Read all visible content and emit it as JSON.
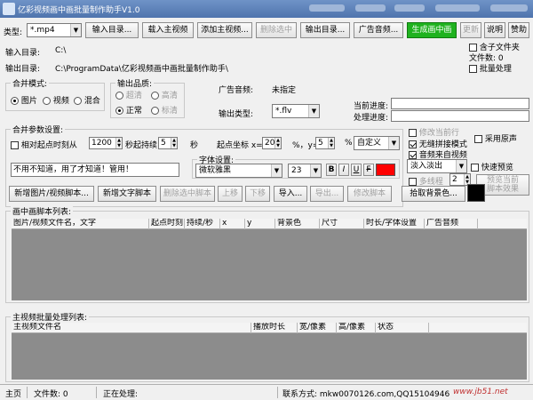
{
  "window": {
    "title": "亿彩视频画中画批量制作助手V1.0"
  },
  "toolbar": {
    "type_label": "类型:",
    "type_value": "*.mp4",
    "input_dir_btn": "输入目录...",
    "load_main_video": "载入主视频",
    "add_main_video": "添加主视频...",
    "delete_selected": "删除选中",
    "output_dir_btn": "输出目录...",
    "ad_audio": "广告音频...",
    "generate_pip": "生成画中画",
    "update": "更新",
    "help": "说明",
    "sponsor": "赞助"
  },
  "paths": {
    "input_label": "输入目录:",
    "input_value": "C:\\",
    "output_label": "输出目录:",
    "output_value": "C:\\ProgramData\\亿彩视频画中画批量制作助手\\"
  },
  "right_options": {
    "include_subfolders": "含子文件夹",
    "file_count": "文件数: 0",
    "batch_processing": "批量处理"
  },
  "merge_mode": {
    "title": "合并模式:",
    "options": [
      "图片",
      "视频",
      "混合"
    ],
    "selected": "图片"
  },
  "output_quality": {
    "title": "输出品质:",
    "options": [
      "超清",
      "高清",
      "正常",
      "标清"
    ],
    "selected": "正常"
  },
  "ad_audio_info": {
    "label": "广告音频:",
    "value": "未指定"
  },
  "output_type": {
    "label": "输出类型:",
    "value": "*.flv"
  },
  "progress": {
    "current_label": "当前进度:",
    "process_label": "处理进度:"
  },
  "merge_params": {
    "title": "合并参数设置:",
    "relative_start": "相对起点时刻从",
    "start_value": "1200",
    "duration_label": "秒起持续",
    "duration_value": "5",
    "seconds": "秒",
    "coord_label": "起点坐标 x=",
    "x_value": "20",
    "pct1": "%，y=",
    "y_value": "5",
    "pct2": "%",
    "custom": "自定义",
    "hint_text": "不用不知道，用了才知道！管用！"
  },
  "right_checks": {
    "modify_current_row": "修改当前行",
    "seamless_mode": "无缝拼接模式",
    "audio_from_video": "音频来自视频",
    "use_original_audio": "采用原声",
    "fade": "淡入淡出",
    "quick_preview": "快速预览",
    "multithread": "多线程",
    "thread_count": "2",
    "preview_current": "预览当前\n脚本效果"
  },
  "font": {
    "title": "字体设置:",
    "family": "微软雅黑",
    "size": "23",
    "bold": "B",
    "italic": "I",
    "underline": "U",
    "strike": "F",
    "color": "#ff0000"
  },
  "script_buttons": {
    "new_media_script": "新增图片/视频脚本...",
    "new_text_script": "新增文字脚本",
    "delete_selected_script": "删除选中脚本",
    "move_up": "上移",
    "move_down": "下移",
    "import": "导入...",
    "export": "导出...",
    "modify_script": "修改脚本",
    "pick_bg_color": "拾取背景色...",
    "bg_swatch": "#000000"
  },
  "pip_list": {
    "title": "画中画脚本列表:",
    "columns": [
      "图片/视频文件名，文字",
      "起点时刻",
      "持续/秒",
      "x",
      "y",
      "背景色",
      "尺寸",
      "时长/字体设置",
      "广告音频"
    ]
  },
  "batch_list": {
    "title": "主视频批量处理列表:",
    "columns": [
      "主视频文件名",
      "播放时长",
      "宽/像素",
      "高/像素",
      "状态"
    ]
  },
  "statusbar": {
    "home": "主页",
    "file_count": "文件数: 0",
    "processing": "正在处理:",
    "contact": "联系方式: mkw0070126.com,QQ15104946",
    "watermark": "www.jb51.net"
  }
}
